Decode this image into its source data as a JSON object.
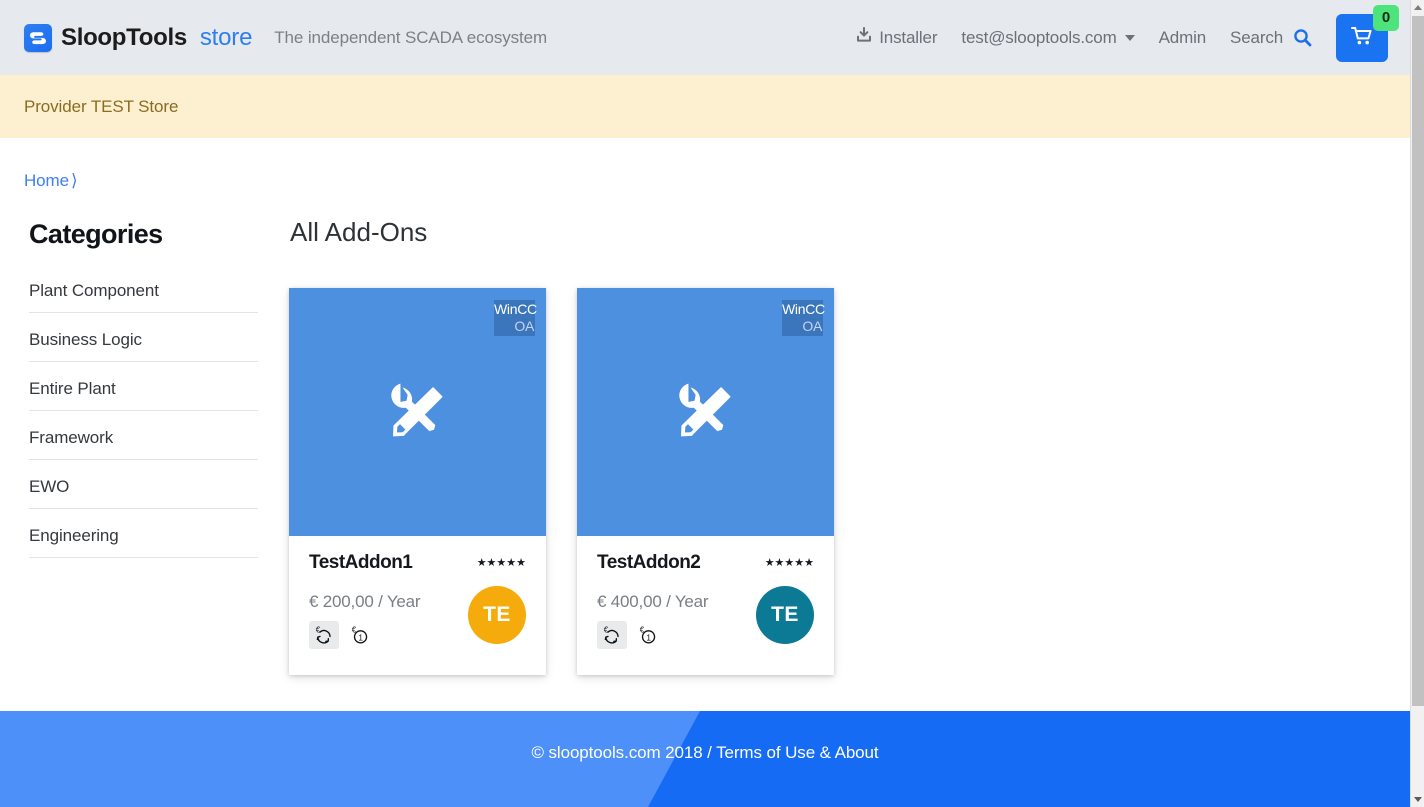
{
  "header": {
    "brand_name": "SloopTools",
    "brand_suffix": "store",
    "tagline": "The independent SCADA ecosystem",
    "logo_icon": "sloop-logo-icon",
    "nav": [
      {
        "label": "Installer",
        "icon": "download-install-icon"
      },
      {
        "label": "test@slooptools.com",
        "icon": "chevron-down-icon"
      },
      {
        "label": "Admin",
        "icon": ""
      },
      {
        "label": "Search",
        "icon": "search-icon"
      }
    ],
    "cart": {
      "icon": "shopping-cart-icon",
      "badge_count": "0",
      "badge_color": "#4ee47c",
      "button_color": "#1a73f0"
    }
  },
  "provider_banner": {
    "text": "Provider TEST Store",
    "background": "#fdf0d1",
    "text_color": "#8a6d22"
  },
  "breadcrumb": {
    "items": [
      {
        "label": "Home"
      }
    ],
    "separator": "⟩"
  },
  "sidebar": {
    "title": "Categories",
    "items": [
      {
        "label": "Plant Component"
      },
      {
        "label": "Business Logic"
      },
      {
        "label": "Entire Plant"
      },
      {
        "label": "Framework"
      },
      {
        "label": "EWO"
      },
      {
        "label": "Engineering"
      }
    ]
  },
  "main": {
    "title": "All Add-Ons",
    "cards": [
      {
        "title": "TestAddon1",
        "tag_line1": "WinCC",
        "tag_line2": "OA",
        "image_icon": "tools-wrench-screwdriver-icon",
        "image_bg": "#4e90e0",
        "rating": "★★★★★",
        "rating_value": 5,
        "price": "€ 200,00 / Year",
        "license_icons": [
          {
            "name": "recurring-subscription-icon",
            "selected": true
          },
          {
            "name": "one-time-purchase-icon",
            "selected": false
          }
        ],
        "avatar_initials": "TE",
        "avatar_color": "#f5ab0c"
      },
      {
        "title": "TestAddon2",
        "tag_line1": "WinCC",
        "tag_line2": "OA",
        "image_icon": "tools-wrench-screwdriver-icon",
        "image_bg": "#4e90e0",
        "rating": "★★★★★",
        "rating_value": 5,
        "price": "€ 400,00 / Year",
        "license_icons": [
          {
            "name": "recurring-subscription-icon",
            "selected": true
          },
          {
            "name": "one-time-purchase-icon",
            "selected": false
          }
        ],
        "avatar_initials": "TE",
        "avatar_color": "#0d7a95"
      }
    ]
  },
  "footer": {
    "text": "© slooptools.com 2018 / Terms of Use & About",
    "color_left": "#4d90fa",
    "color_right": "#166bf5"
  },
  "scrollbar": {
    "up_arrow": "scroll-up-arrow-icon",
    "down_arrow": "scroll-down-arrow-icon"
  }
}
